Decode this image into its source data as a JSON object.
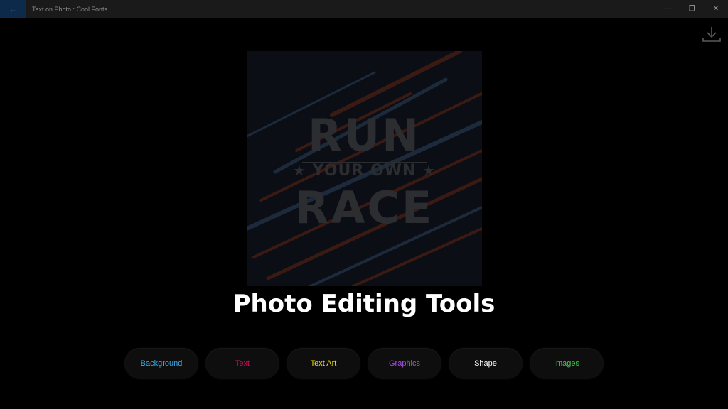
{
  "window": {
    "title": "Text on Photo : Cool Fonts",
    "back_label": "←",
    "minimize_label": "—",
    "maximize_label": "❐",
    "close_label": "✕"
  },
  "poster": {
    "line1": "RUN",
    "line2": "YOUR OWN",
    "line3": "RACE",
    "star": "★"
  },
  "headline": "Photo Editing Tools",
  "tools": [
    {
      "label": "Background",
      "color": "#3fa9e6"
    },
    {
      "label": "Text",
      "color": "#c0175f"
    },
    {
      "label": "Text Art",
      "color": "#f2e200"
    },
    {
      "label": "Graphics",
      "color": "#a84fe0"
    },
    {
      "label": "Shape",
      "color": "#ffffff"
    },
    {
      "label": "Images",
      "color": "#3fce4a"
    }
  ],
  "icons": {
    "download": "download-icon"
  }
}
